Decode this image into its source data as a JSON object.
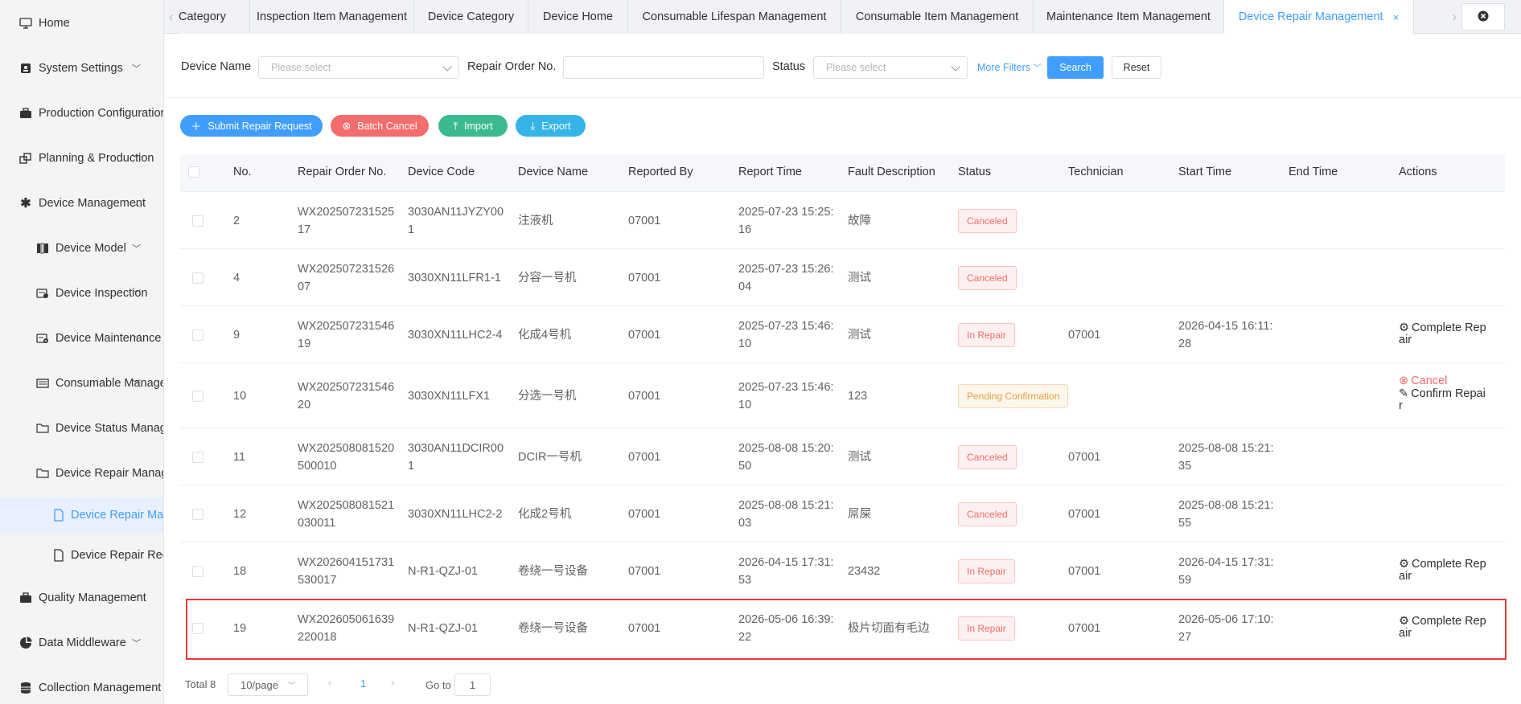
{
  "sidebar": {
    "items": [
      {
        "label": "Home",
        "icon": "monitor-icon"
      },
      {
        "label": "System Settings",
        "icon": "settings-box-icon"
      },
      {
        "label": "Production Configuration",
        "icon": "briefcase-icon"
      },
      {
        "label": "Planning & Production",
        "icon": "layers-icon"
      },
      {
        "label": "Device Management",
        "icon": "asterisk-icon"
      },
      {
        "label": "Device Model",
        "icon": "device-model-icon"
      },
      {
        "label": "Device Inspection",
        "icon": "inspection-icon"
      },
      {
        "label": "Device Maintenance",
        "icon": "maintenance-icon"
      },
      {
        "label": "Consumable Management",
        "icon": "list-icon"
      },
      {
        "label": "Device Status Management",
        "icon": "folder-icon"
      },
      {
        "label": "Device Repair Management",
        "icon": "folder-icon"
      },
      {
        "label": "Device Repair Management",
        "icon": "file-icon"
      },
      {
        "label": "Device Repair Records",
        "icon": "file-icon"
      },
      {
        "label": "Quality Management",
        "icon": "briefcase-icon"
      },
      {
        "label": "Data Middleware",
        "icon": "pie-icon"
      },
      {
        "label": "Collection Management",
        "icon": "database-icon"
      }
    ]
  },
  "tabs": {
    "items": [
      {
        "label": "Category"
      },
      {
        "label": "Inspection Item Management"
      },
      {
        "label": "Device Category"
      },
      {
        "label": "Device Home"
      },
      {
        "label": "Consumable Lifespan Management"
      },
      {
        "label": "Consumable Item Management"
      },
      {
        "label": "Maintenance Item Management"
      },
      {
        "label": "Device Repair Management"
      }
    ],
    "close_glyph": "×"
  },
  "filters": {
    "device_name_label": "Device Name",
    "device_name_placeholder": "Please select",
    "repair_order_label": "Repair Order No.",
    "status_label": "Status",
    "status_placeholder": "Please select",
    "more_filters": "More Filters",
    "search": "Search",
    "reset": "Reset"
  },
  "actions": {
    "submit": "Submit Repair Request",
    "batch_cancel": "Batch Cancel",
    "import": "Import",
    "export": "Export"
  },
  "table": {
    "headers": [
      "No.",
      "Repair Order No.",
      "Device Code",
      "Device Name",
      "Reported By",
      "Report Time",
      "Fault Description",
      "Status",
      "Technician",
      "Start Time",
      "End Time",
      "Actions"
    ],
    "rows": [
      {
        "no": "2",
        "order": [
          "WX202507231525",
          "17"
        ],
        "code": [
          "3030AN11JYZY00",
          "1"
        ],
        "name": "注液机",
        "reporter": "07001",
        "report_time": [
          "2025-07-23 15:25:",
          "16"
        ],
        "fault": "故障",
        "status": "Canceled",
        "technician": "",
        "start": [
          "",
          ""
        ],
        "end": "",
        "actions": []
      },
      {
        "no": "4",
        "order": [
          "WX202507231526",
          "07"
        ],
        "code": [
          "3030XN11LFR1-1",
          ""
        ],
        "name": "分容一号机",
        "reporter": "07001",
        "report_time": [
          "2025-07-23 15:26:",
          "04"
        ],
        "fault": "测试",
        "status": "Canceled",
        "technician": "",
        "start": [
          "",
          ""
        ],
        "end": "",
        "actions": []
      },
      {
        "no": "9",
        "order": [
          "WX202507231546",
          "19"
        ],
        "code": [
          "3030XN11LHC2-4",
          ""
        ],
        "name": "化成4号机",
        "reporter": "07001",
        "report_time": [
          "2025-07-23 15:46:",
          "10"
        ],
        "fault": "测试",
        "status": "In Repair",
        "technician": "07001",
        "start": [
          "2026-04-15 16:11:",
          "28"
        ],
        "end": "",
        "actions": [
          {
            "label": [
              "Complete Rep",
              "air"
            ],
            "icon": "gear"
          }
        ]
      },
      {
        "no": "10",
        "order": [
          "WX202507231546",
          "20"
        ],
        "code": [
          "3030XN11LFX1",
          ""
        ],
        "name": "分选一号机",
        "reporter": "07001",
        "report_time": [
          "2025-07-23 15:46:",
          "10"
        ],
        "fault": "123",
        "status": "Pending Confirmation",
        "technician": "",
        "start": [
          "",
          ""
        ],
        "end": "",
        "actions": [
          {
            "label": [
              "Cancel"
            ],
            "icon": "cancel"
          },
          {
            "label": [
              "Confirm Repai",
              "r"
            ],
            "icon": "pen"
          }
        ]
      },
      {
        "no": "11",
        "order": [
          "WX202508081520",
          "500010"
        ],
        "code": [
          "3030AN11DCIR00",
          "1"
        ],
        "name": "DCIR一号机",
        "reporter": "07001",
        "report_time": [
          "2025-08-08 15:20:",
          "50"
        ],
        "fault": "测试",
        "status": "Canceled",
        "technician": "07001",
        "start": [
          "2025-08-08 15:21:",
          "35"
        ],
        "end": "",
        "actions": []
      },
      {
        "no": "12",
        "order": [
          "WX202508081521",
          "030011"
        ],
        "code": [
          "3030XN11LHC2-2",
          ""
        ],
        "name": "化成2号机",
        "reporter": "07001",
        "report_time": [
          "2025-08-08 15:21:",
          "03"
        ],
        "fault": "屌屎",
        "status": "Canceled",
        "technician": "07001",
        "start": [
          "2025-08-08 15:21:",
          "55"
        ],
        "end": "",
        "actions": []
      },
      {
        "no": "18",
        "order": [
          "WX202604151731",
          "530017"
        ],
        "code": [
          "N-R1-QZJ-01",
          ""
        ],
        "name": "卷绕一号设备",
        "reporter": "07001",
        "report_time": [
          "2026-04-15 17:31:",
          "53"
        ],
        "fault": "23432",
        "status": "In Repair",
        "technician": "07001",
        "start": [
          "2026-04-15 17:31:",
          "59"
        ],
        "end": "",
        "actions": [
          {
            "label": [
              "Complete Rep",
              "air"
            ],
            "icon": "gear"
          }
        ]
      },
      {
        "no": "19",
        "order": [
          "WX202605061639",
          "220018"
        ],
        "code": [
          "N-R1-QZJ-01",
          ""
        ],
        "name": "卷绕一号设备",
        "reporter": "07001",
        "report_time": [
          "2026-05-06 16:39:",
          "22"
        ],
        "fault": "极片切面有毛边",
        "status": "In Repair",
        "technician": "07001",
        "start": [
          "2026-05-06 17:10:",
          "27"
        ],
        "end": "",
        "actions": [
          {
            "label": [
              "Complete Rep",
              "air"
            ],
            "icon": "gear"
          }
        ]
      }
    ]
  },
  "pagination": {
    "total": "Total 8",
    "page_size": "10/page",
    "current_page": "1",
    "goto_label": "Go to",
    "goto_value": "1"
  },
  "colors": {
    "primary": "#409eff",
    "danger": "#f56c6c",
    "success": "#3cba8f",
    "info": "#36b4e8",
    "warning": "#e6a23c",
    "highlight": "#e53935"
  }
}
